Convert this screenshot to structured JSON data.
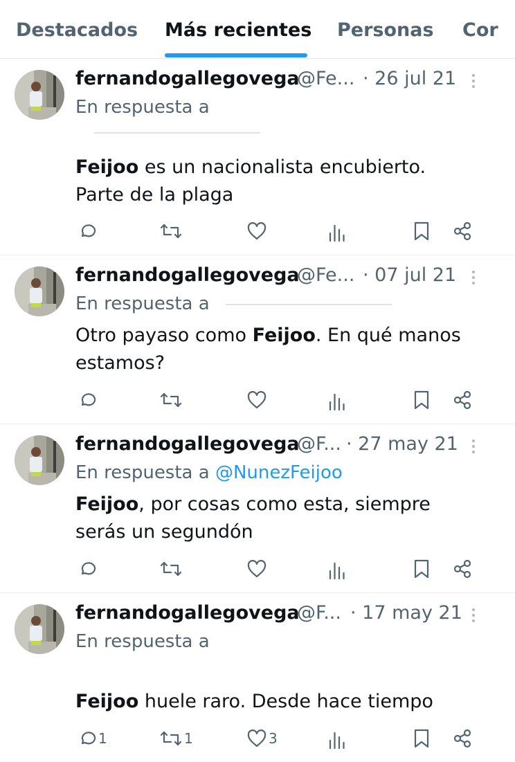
{
  "tabs": [
    {
      "label": "Destacados",
      "active": false
    },
    {
      "label": "Más recientes",
      "active": true
    },
    {
      "label": "Personas",
      "active": false
    },
    {
      "label": "Cor",
      "active": false
    }
  ],
  "colors": {
    "accent": "#1d9bf0",
    "text": "#0f1419",
    "secondary": "#536471"
  },
  "icons": [
    "reply-icon",
    "retweet-icon",
    "like-icon",
    "views-icon",
    "bookmark-icon",
    "share-icon",
    "more-icon"
  ],
  "tweets": [
    {
      "name": "fernandogallegovega",
      "handle": "@Fe...",
      "date": "· 26 jul 21",
      "reply_prefix": "En respuesta a",
      "reply_user": "",
      "line1_bold": "Feijoo",
      "line1": " es un nacionalista encubierto.",
      "line2": "Parte de la plaga",
      "counts": {
        "replies": "",
        "retweets": "",
        "likes": ""
      }
    },
    {
      "name": "fernandogallegovega",
      "handle": "@Fe...",
      "date": "· 07 jul 21",
      "reply_prefix": "En respuesta a",
      "reply_user": "",
      "line1_pre": "Otro payaso como ",
      "line1_bold": "Feijoo",
      "line1": ". En qué manos",
      "line2": "estamos?",
      "counts": {
        "replies": "",
        "retweets": "",
        "likes": ""
      }
    },
    {
      "name": "fernandogallegovega",
      "handle": "@F...",
      "date": "· 27 may 21",
      "reply_prefix": "En respuesta a",
      "reply_user": "@NunezFeijoo",
      "line1_bold": "Feijoo",
      "line1": ", por cosas como esta, siempre",
      "line2": "serás un segundón",
      "counts": {
        "replies": "",
        "retweets": "",
        "likes": ""
      }
    },
    {
      "name": "fernandogallegovega",
      "handle": "@F...",
      "date": "· 17 may 21",
      "reply_prefix": "En respuesta a",
      "reply_user": "",
      "line1_bold": "Feijoo",
      "line1": " huele raro. Desde hace tiempo",
      "counts": {
        "replies": "1",
        "retweets": "1",
        "likes": "3"
      }
    }
  ]
}
